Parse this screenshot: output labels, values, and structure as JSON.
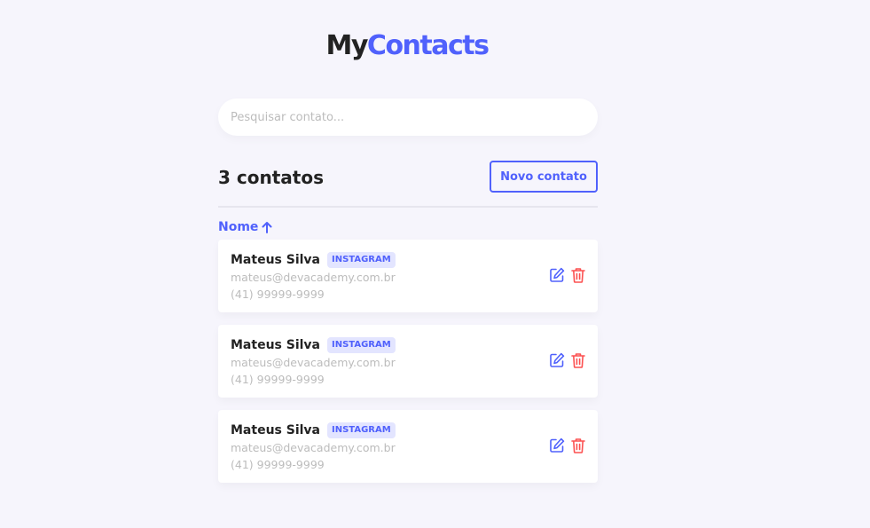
{
  "brand": {
    "part1": "My",
    "part2": "Contacts"
  },
  "search": {
    "placeholder": "Pesquisar contato...",
    "value": ""
  },
  "header": {
    "count_label": "3 contatos",
    "new_button_label": "Novo contato"
  },
  "sort": {
    "label": "Nome",
    "direction_icon": "arrow-up-icon"
  },
  "contacts": [
    {
      "name": "Mateus Silva",
      "category": "INSTAGRAM",
      "email": "mateus@devacademy.com.br",
      "phone": "(41) 99999-9999"
    },
    {
      "name": "Mateus Silva",
      "category": "INSTAGRAM",
      "email": "mateus@devacademy.com.br",
      "phone": "(41) 99999-9999"
    },
    {
      "name": "Mateus Silva",
      "category": "INSTAGRAM",
      "email": "mateus@devacademy.com.br",
      "phone": "(41) 99999-9999"
    }
  ],
  "icons": {
    "edit": "edit-icon",
    "delete": "trash-icon"
  },
  "colors": {
    "primary": "#5061FC",
    "danger": "#FC5050",
    "background": "#F6F5FC",
    "text": "#222222",
    "muted": "#BCBCBC",
    "badge_bg": "#E3E5FF"
  }
}
